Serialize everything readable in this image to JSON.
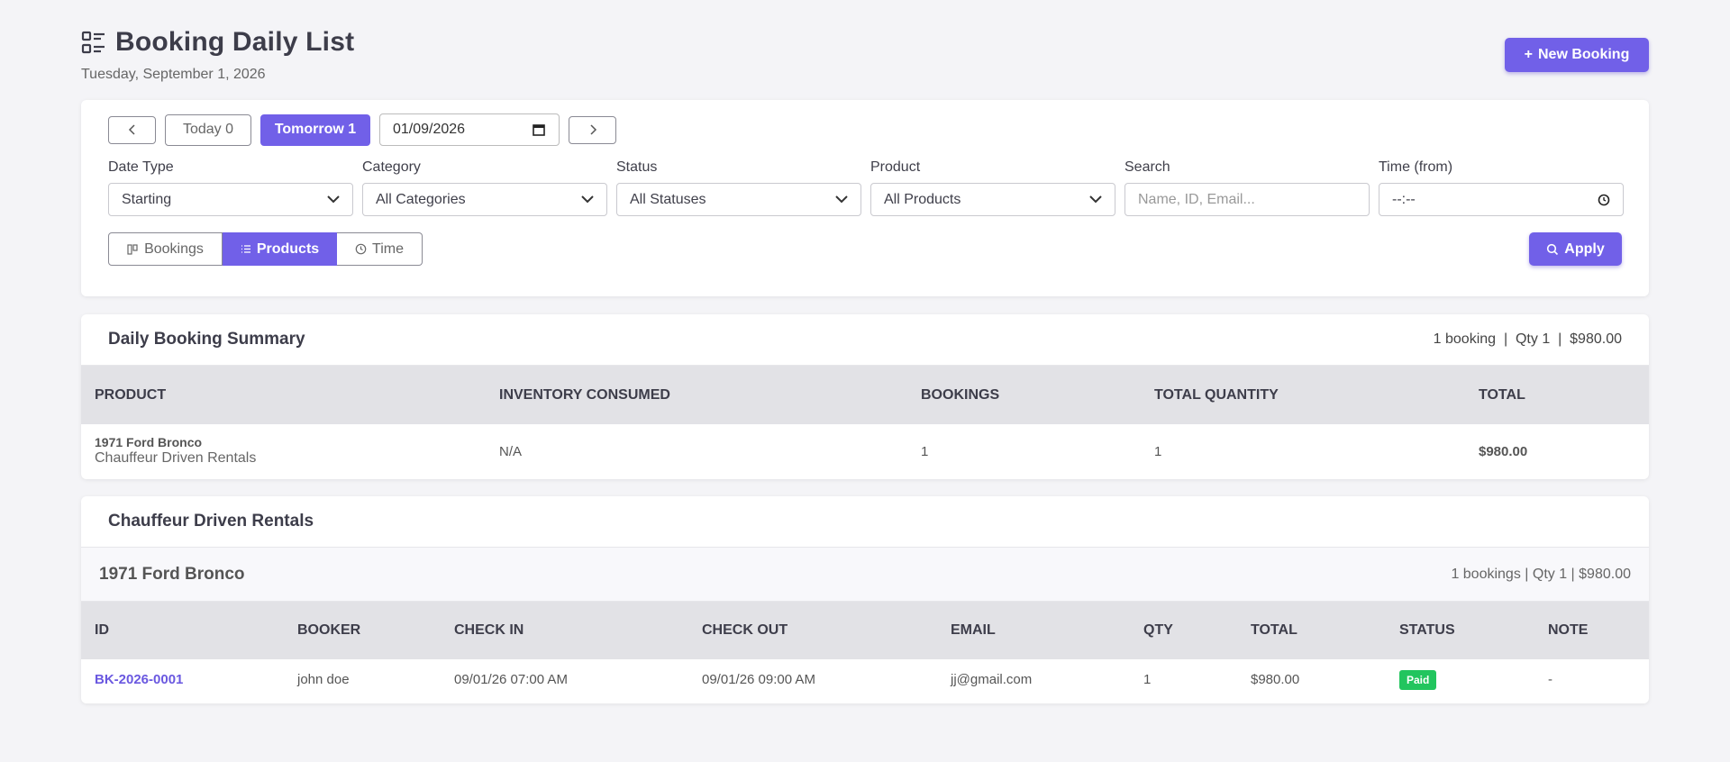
{
  "header": {
    "title": "Booking Daily List",
    "date": "Tuesday, September 1, 2026",
    "new_booking_label": "New Booking"
  },
  "nav": {
    "prev": "<",
    "today": "Today 0",
    "tomorrow": "Tomorrow 1",
    "date_value": "01/09/2026",
    "next": ">"
  },
  "filters": {
    "date_type": {
      "label": "Date Type",
      "value": "Starting"
    },
    "category": {
      "label": "Category",
      "value": "All Categories"
    },
    "status": {
      "label": "Status",
      "value": "All Statuses"
    },
    "product": {
      "label": "Product",
      "value": "All Products"
    },
    "search": {
      "label": "Search",
      "placeholder": "Name, ID, Email..."
    },
    "time": {
      "label": "Time (from)",
      "value": "--:--"
    }
  },
  "views": {
    "bookings": "Bookings",
    "products": "Products",
    "time": "Time",
    "active": "products"
  },
  "apply_label": "Apply",
  "summary": {
    "title": "Daily Booking Summary",
    "meta": "1 booking  |  Qty 1  |  $980.00",
    "columns": [
      "PRODUCT",
      "INVENTORY CONSUMED",
      "BOOKINGS",
      "TOTAL QUANTITY",
      "TOTAL"
    ],
    "rows": [
      {
        "product": "1971 Ford Bronco",
        "category": "Chauffeur Driven Rentals",
        "inventory": "N/A",
        "bookings": "1",
        "quantity": "1",
        "total": "$980.00"
      }
    ]
  },
  "rentals": {
    "title": "Chauffeur Driven Rentals",
    "product_title": "1971 Ford Bronco",
    "product_meta": "1 bookings | Qty 1 | $980.00",
    "columns": [
      "ID",
      "BOOKER",
      "CHECK IN",
      "CHECK OUT",
      "EMAIL",
      "QTY",
      "TOTAL",
      "STATUS",
      "NOTE"
    ],
    "rows": [
      {
        "id": "BK-2026-0001",
        "booker": "john doe",
        "check_in": "09/01/26 07:00 AM",
        "check_out": "09/01/26 09:00 AM",
        "email": "jj@gmail.com",
        "qty": "1",
        "total": "$980.00",
        "status": "Paid",
        "note": "-"
      }
    ]
  },
  "colors": {
    "accent": "#7160e8",
    "paid": "#22c55e"
  }
}
